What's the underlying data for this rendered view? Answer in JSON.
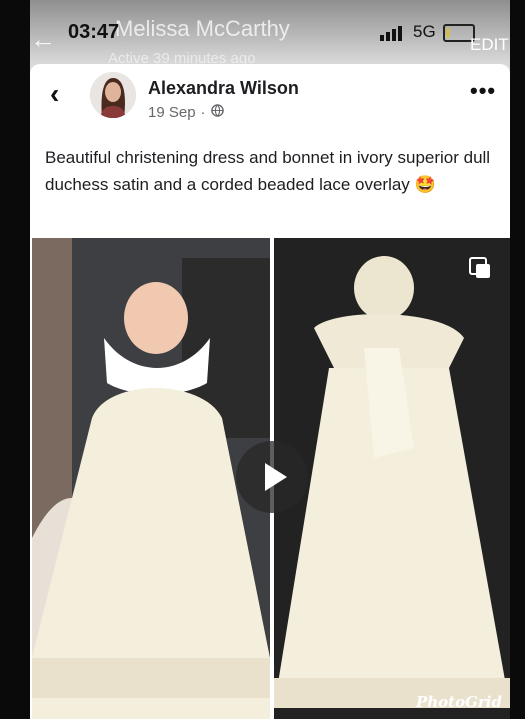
{
  "status_bar": {
    "time": "03:47",
    "network": "5G",
    "battery_percent": 10
  },
  "overlay": {
    "chat_name": "Melissa McCarthy",
    "active_status": "Active 39 minutes ago",
    "edit_label": "EDIT"
  },
  "post": {
    "author": "Alexandra Wilson",
    "date": "19 Sep",
    "privacy_icon": "globe-icon",
    "text": "Beautiful christening dress and bonnet in ivory superior dull duchess satin and a corded beaded lace overlay 🤩"
  },
  "media": {
    "watermark": "PhotoGrid",
    "type_icon": "play-icon"
  },
  "colors": {
    "dress": "#f4efdc",
    "text": "#1c1e21",
    "meta": "#65676b"
  }
}
